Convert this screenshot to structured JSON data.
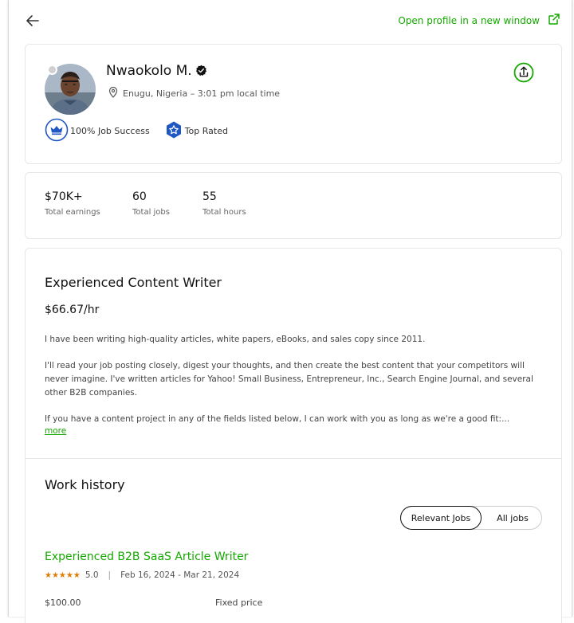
{
  "header": {
    "open_profile": "Open profile in a new window"
  },
  "profile": {
    "name": "Nwaokolo M.",
    "location": "Enugu, Nigeria – 3:01 pm local time",
    "job_success": "100% Job Success",
    "top_rated": "Top Rated"
  },
  "stats": [
    {
      "value": "$70K+",
      "label": "Total earnings"
    },
    {
      "value": "60",
      "label": "Total jobs"
    },
    {
      "value": "55",
      "label": "Total hours"
    }
  ],
  "overview": {
    "title": "Experienced Content Writer",
    "rate": "$66.67/hr",
    "p1": "I have been writing high-quality articles, white papers, eBooks, and sales copy since 2011.",
    "p2": "I'll read your job posting closely, digest your thoughts, and then create the best content that your competitors will never imagine. I've written articles for Yahoo! Small Business, Entrepreneur, Inc., Search Engine Journal, and several other B2B companies.",
    "p3": "If you have a content project in any of the fields listed below, I can work with you as long as we're a good fit:...",
    "more": "more"
  },
  "work_history": {
    "heading": "Work history",
    "tabs": [
      "Relevant Jobs",
      "All jobs"
    ],
    "jobs": [
      {
        "title": "Experienced B2B SaaS Article Writer",
        "stars": "★★★★★",
        "rating": "5.0",
        "dates": "Feb 16, 2024 - Mar 21, 2024",
        "price": "$100.00",
        "type": "Fixed price"
      }
    ]
  },
  "colors": {
    "accent": "#14a800",
    "star": "#e07b00",
    "badge_blue": "#1f57c3"
  }
}
